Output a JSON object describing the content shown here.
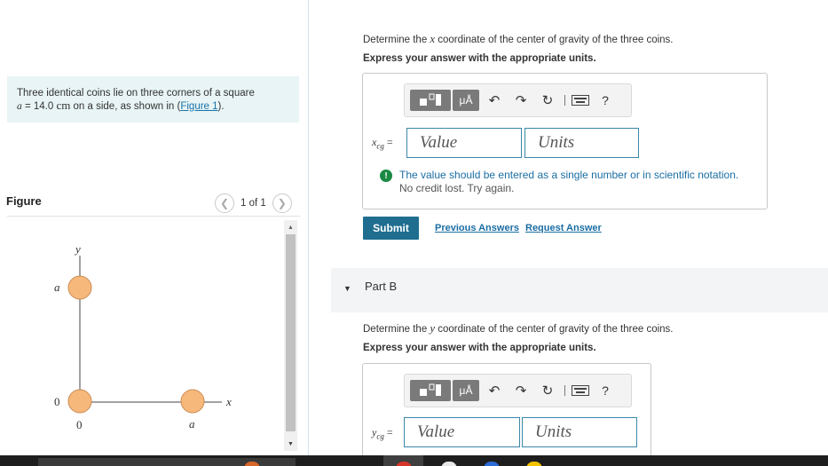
{
  "problem": {
    "text_before": "Three identical coins lie on three corners of a square",
    "var_a": "a",
    "equals_value": " = 14.0 ",
    "unit": "cm",
    "text_after": " on a side, as shown in (",
    "figure_link": "Figure 1",
    "text_end": ")."
  },
  "figure": {
    "label": "Figure",
    "pager_text": "1 of 1",
    "prev_icon": "chevron-left-icon",
    "next_icon": "chevron-right-icon",
    "axis_y_label": "y",
    "axis_x_label": "x",
    "tick_a_y": "a",
    "tick_0_y": "0",
    "tick_0_x": "0",
    "tick_a_x": "a",
    "coin_color": "#f7b87b",
    "coin_stroke": "#c98c55"
  },
  "part_a": {
    "question_before": "Determine the ",
    "question_var": "x",
    "question_after": " coordinate of the center of gravity of the three coins.",
    "instruction": "Express your answer with the appropriate units.",
    "var_main": "x",
    "var_sub": "cg",
    "value_placeholder": "Value",
    "units_placeholder": "Units",
    "feedback_line1": "The value should be entered as a single number or in scientific notation.",
    "feedback_line2": "No credit lost. Try again.",
    "submit_label": "Submit",
    "previous_answers_label": "Previous Answers",
    "request_answer_label": "Request Answer"
  },
  "toolbar": {
    "units_button_label": "μÅ",
    "help_label": "?",
    "icons": [
      "template-icon",
      "units-icon",
      "undo-icon",
      "redo-icon",
      "reset-icon",
      "keyboard-icon",
      "help-icon"
    ]
  },
  "part_b": {
    "title": "Part B",
    "question_before": "Determine the ",
    "question_var": "y",
    "question_after": " coordinate of the center of gravity of the three coins.",
    "instruction": "Express your answer with the appropriate units.",
    "var_main": "y",
    "var_sub": "cg",
    "value_placeholder": "Value",
    "units_placeholder": "Units"
  },
  "colors": {
    "accent": "#1f6e8f",
    "link": "#1a6ea3",
    "feedback_icon": "#1a8a43",
    "problem_bg": "#e8f4f5"
  }
}
